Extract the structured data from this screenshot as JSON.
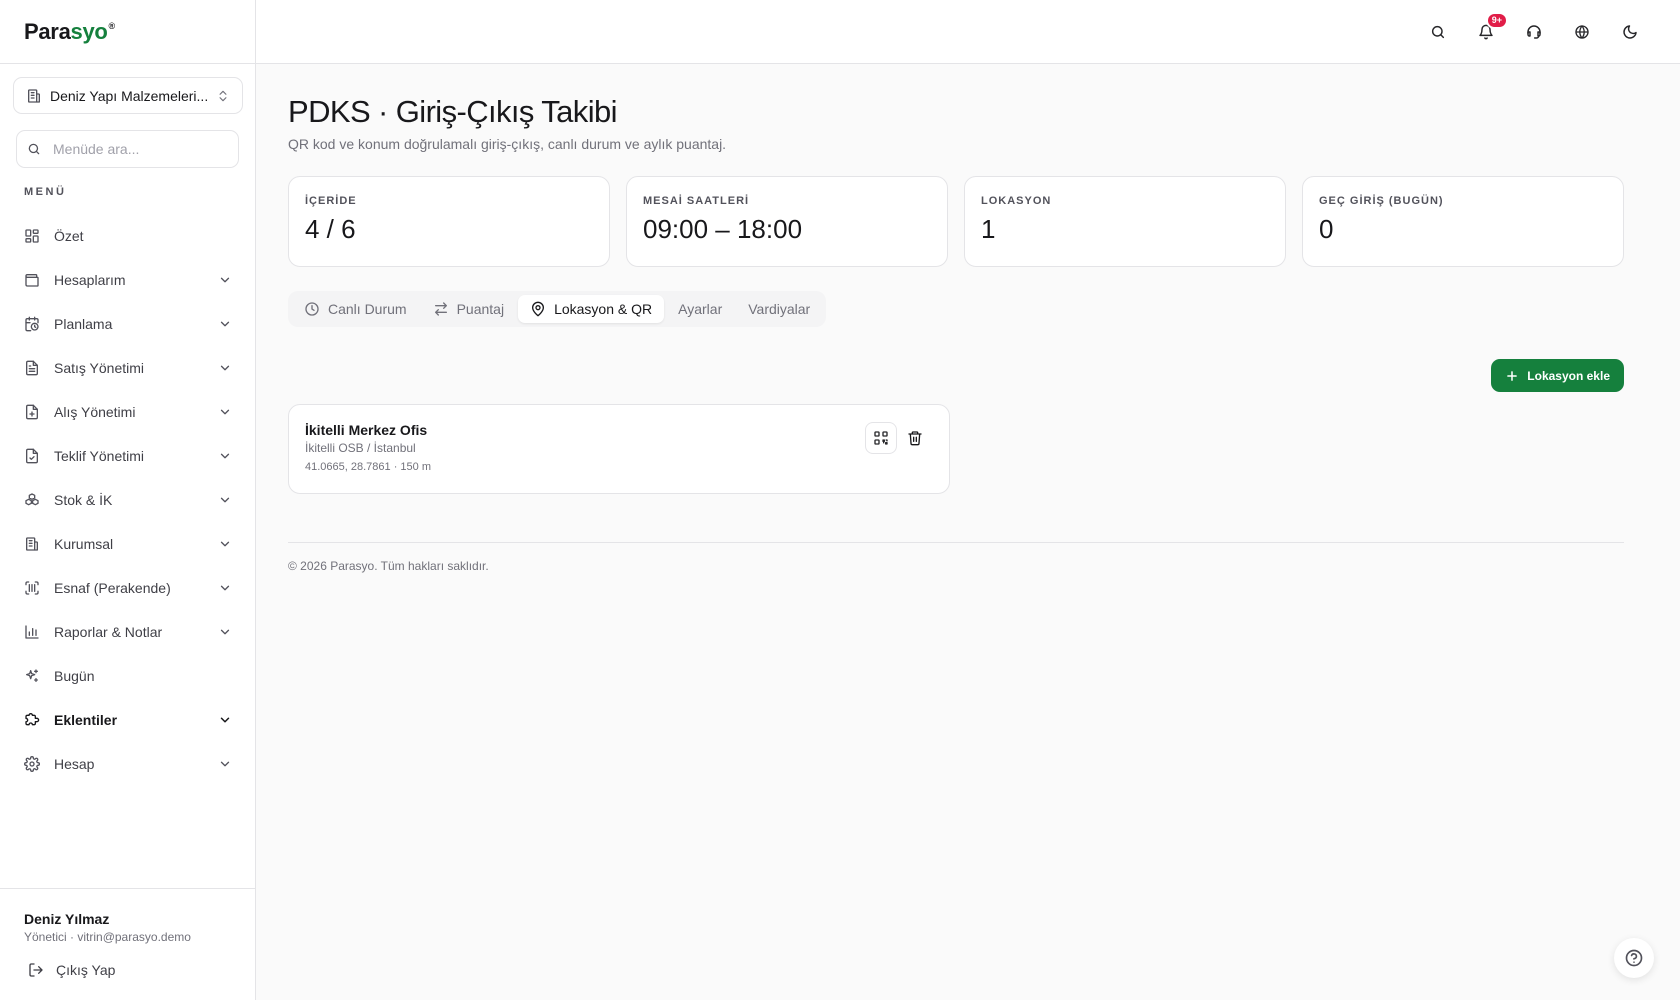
{
  "brand": {
    "part1": "Para",
    "part2": "syo",
    "mark": "®"
  },
  "company_switcher": {
    "label": "Deniz Yapı Malzemeleri..."
  },
  "menu_search": {
    "placeholder": "Menüde ara..."
  },
  "menu_section_title": "MENÜ",
  "nav": [
    {
      "label": "Özet",
      "icon": "dashboard-icon",
      "has_chevron": false
    },
    {
      "label": "Hesaplarım",
      "icon": "wallet-icon",
      "has_chevron": true
    },
    {
      "label": "Planlama",
      "icon": "calendar-clock-icon",
      "has_chevron": true
    },
    {
      "label": "Satış Yönetimi",
      "icon": "receipt-icon",
      "has_chevron": true
    },
    {
      "label": "Alış Yönetimi",
      "icon": "file-plus-icon",
      "has_chevron": true
    },
    {
      "label": "Teklif Yönetimi",
      "icon": "file-check-icon",
      "has_chevron": true
    },
    {
      "label": "Stok & İK",
      "icon": "boxes-icon",
      "has_chevron": true
    },
    {
      "label": "Kurumsal",
      "icon": "building-icon",
      "has_chevron": true
    },
    {
      "label": "Esnaf (Perakende)",
      "icon": "barcode-scan-icon",
      "has_chevron": true
    },
    {
      "label": "Raporlar & Notlar",
      "icon": "bar-chart-icon",
      "has_chevron": true
    },
    {
      "label": "Bugün",
      "icon": "sparkles-icon",
      "has_chevron": false
    },
    {
      "label": "Eklentiler",
      "icon": "puzzle-icon",
      "has_chevron": true,
      "active": true
    },
    {
      "label": "Hesap",
      "icon": "gear-icon",
      "has_chevron": true
    }
  ],
  "user": {
    "name": "Deniz Yılmaz",
    "meta": "Yönetici · vitrin@parasyo.demo",
    "logout_label": "Çıkış Yap"
  },
  "topbar": {
    "notification_badge": "9+"
  },
  "page": {
    "title": "PDKS · Giriş-Çıkış Takibi",
    "subtitle": "QR kod ve konum doğrulamalı giriş-çıkış, canlı durum ve aylık puantaj."
  },
  "stats": [
    {
      "label": "İÇERİDE",
      "value": "4 / 6"
    },
    {
      "label": "MESAİ SAATLERİ",
      "value": "09:00 – 18:00"
    },
    {
      "label": "LOKASYON",
      "value": "1"
    },
    {
      "label": "GEÇ GİRİŞ (BUGÜN)",
      "value": "0"
    }
  ],
  "tabs": [
    {
      "label": "Canlı Durum",
      "icon": "clock-icon"
    },
    {
      "label": "Puantaj",
      "icon": "swap-arrows-icon"
    },
    {
      "label": "Lokasyon & QR",
      "icon": "map-pin-icon",
      "active": true
    },
    {
      "label": "Ayarlar"
    },
    {
      "label": "Vardiyalar"
    }
  ],
  "add_location_label": "Lokasyon ekle",
  "location": {
    "name": "İkitelli Merkez Ofis",
    "address": "İkitelli OSB / İstanbul",
    "coords": "41.0665, 28.7861 · 150 m"
  },
  "footer": "© 2026 Parasyo. Tüm hakları saklıdır.",
  "colors": {
    "accent": "#15803d",
    "badge": "#e11d48",
    "border": "#e4e4e7",
    "background": "#fafafa"
  }
}
